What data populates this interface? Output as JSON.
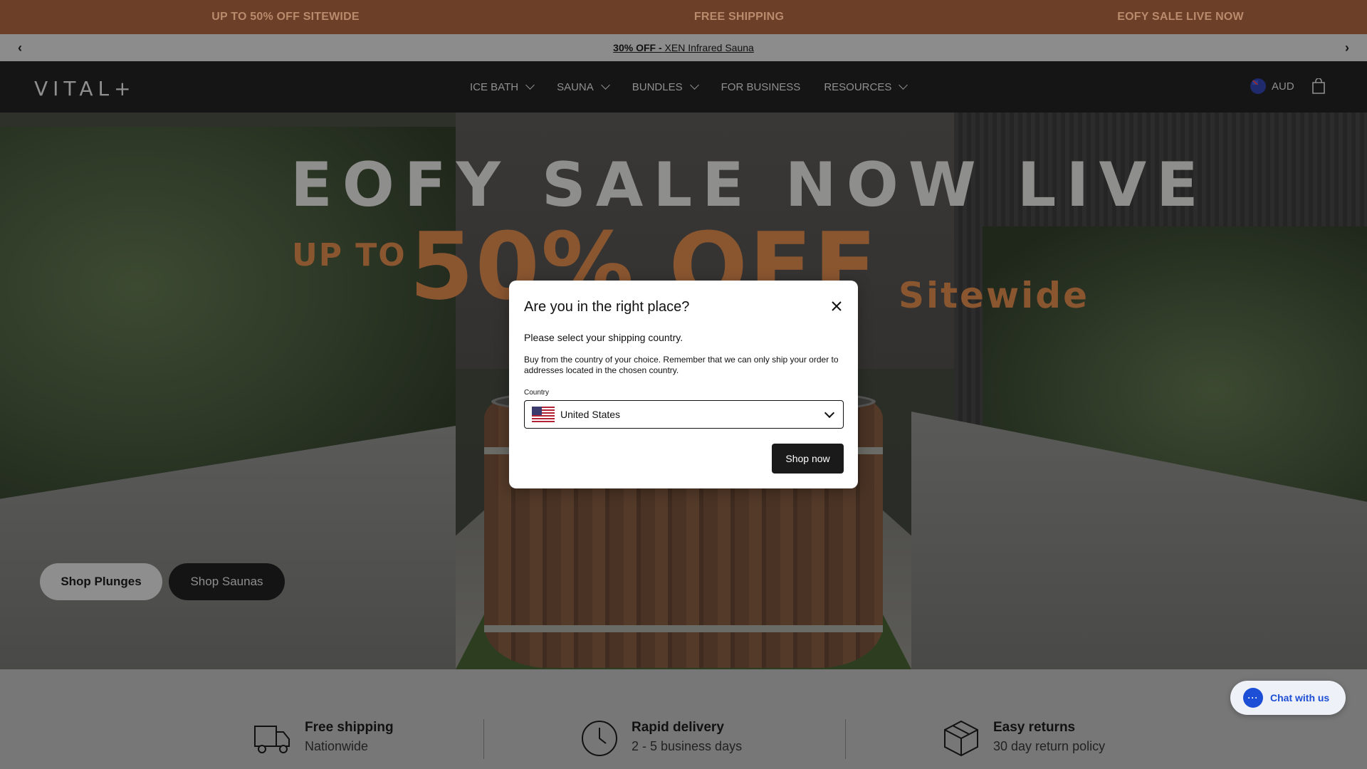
{
  "promo_bar": {
    "items": [
      "UP TO 50% OFF SITEWIDE",
      "FREE SHIPPING",
      "EOFY SALE LIVE NOW"
    ]
  },
  "announcement": {
    "bold": "30% OFF -",
    "text": " XEN Infrared Sauna",
    "prev_icon": "chevron-left-icon",
    "next_icon": "chevron-right-icon"
  },
  "header": {
    "logo": "VITAL+",
    "nav": [
      {
        "label": "ICE BATH",
        "has_dropdown": true
      },
      {
        "label": "SAUNA",
        "has_dropdown": true
      },
      {
        "label": "BUNDLES",
        "has_dropdown": true
      },
      {
        "label": "FOR BUSINESS",
        "has_dropdown": false
      },
      {
        "label": "RESOURCES",
        "has_dropdown": true
      }
    ],
    "currency": "AUD",
    "cart_icon": "shopping-bag-icon"
  },
  "hero": {
    "headline": "EOFY SALE NOW LIVE",
    "up_to": "UP TO",
    "percent": "50% OFF",
    "sitewide": "Sitewide",
    "buttons": {
      "plunges": "Shop Plunges",
      "saunas": "Shop Saunas"
    }
  },
  "features": [
    {
      "icon": "truck-icon",
      "title": "Free shipping",
      "subtitle": "Nationwide"
    },
    {
      "icon": "clock-icon",
      "title": "Rapid delivery",
      "subtitle": "2 - 5 business days"
    },
    {
      "icon": "box-icon",
      "title": "Easy returns",
      "subtitle": "30 day return policy"
    }
  ],
  "modal": {
    "title": "Are you in the right place?",
    "subtitle": "Please select your shipping country.",
    "body": "Buy from the country of your choice. Remember that we can only ship your order to addresses located in the chosen country.",
    "country_label": "Country",
    "country_value": "United States",
    "submit_label": "Shop now",
    "close_icon": "close-icon"
  },
  "chat": {
    "label": "Chat with us",
    "icon_text": "···"
  },
  "colors": {
    "promo_bg": "#6b3f28",
    "header_bg": "#151515",
    "accent_orange": "#8a5630",
    "chat_blue": "#1d4fd6"
  }
}
